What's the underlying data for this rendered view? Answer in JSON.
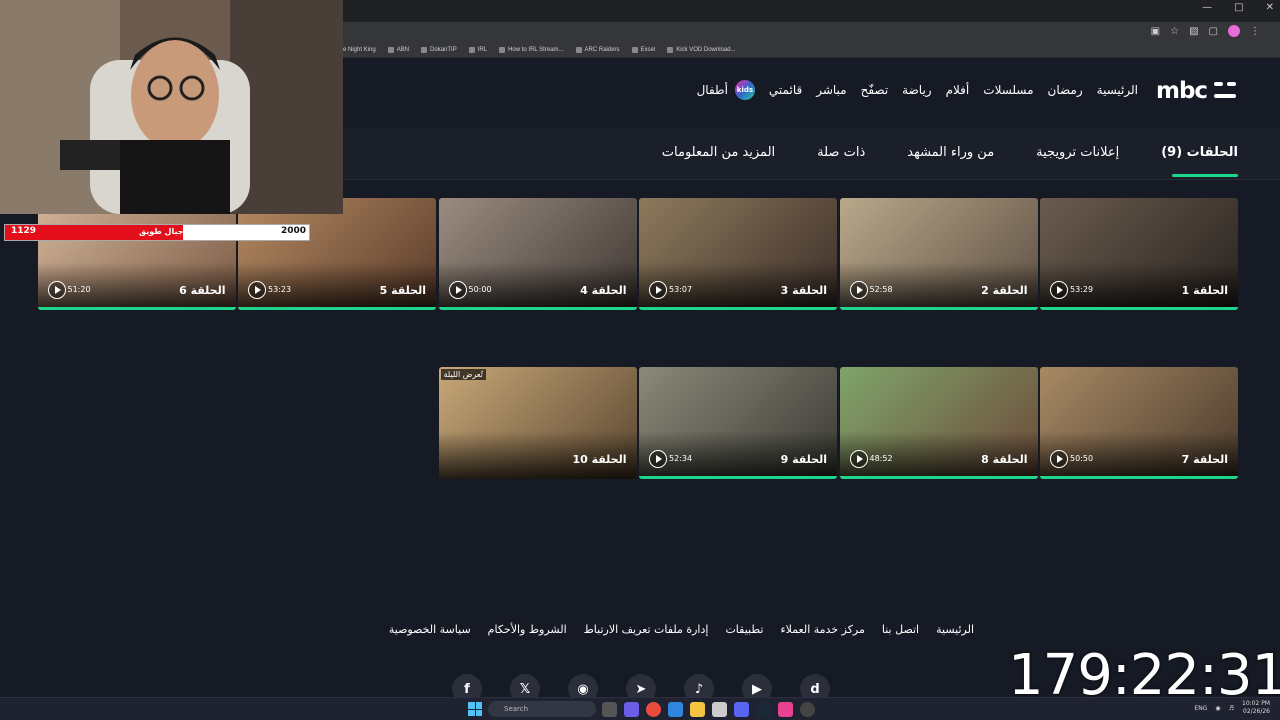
{
  "browser": {
    "bookmarks": [
      "e Night King",
      "ABN",
      "DokanTIP",
      "IRL",
      "How to IRL Stream...",
      "ARC Raiders",
      "Excel",
      "Kick VOD Download..."
    ]
  },
  "site": {
    "logo": "mbc",
    "nav": [
      "الرئيسية",
      "رمضان",
      "مسلسلات",
      "أفلام",
      "رياضة",
      "تصفّح",
      "مباشر",
      "قائمتي"
    ],
    "nav_kids_label": "أطفال",
    "kids_badge": "kids",
    "tabs": [
      "الحلقات (9)",
      "إعلانات ترويجية",
      "من وراء المشهد",
      "ذات صلة",
      "المزيد من المعلومات"
    ],
    "episodes": [
      {
        "title": "الحلقة 1",
        "duration": "53:29"
      },
      {
        "title": "الحلقة 2",
        "duration": "52:58"
      },
      {
        "title": "الحلقة 3",
        "duration": "53:07"
      },
      {
        "title": "الحلقة 4",
        "duration": "50:00"
      },
      {
        "title": "الحلقة 5",
        "duration": "53:23"
      },
      {
        "title": "الحلقة 6",
        "duration": "51:20"
      },
      {
        "title": "الحلقة 7",
        "duration": "50:50"
      },
      {
        "title": "الحلقة 8",
        "duration": "48:52"
      },
      {
        "title": "الحلقة 9",
        "duration": "52:34"
      },
      {
        "title": "الحلقة 10",
        "duration": "",
        "badge": "تُعرض الليلة"
      }
    ],
    "footer_links": [
      "الرئيسية",
      "اتصل بنا",
      "مركز خدمة العملاء",
      "تطبيقات",
      "إدارة ملفات تعريف الارتباط",
      "الشروط والأحكام",
      "سياسة الخصوصية"
    ],
    "social": [
      "shahid-icon",
      "youtube-icon",
      "tiktok-icon",
      "telegram-icon",
      "instagram-icon",
      "x-icon",
      "facebook-icon"
    ]
  },
  "overlay": {
    "score_left": "1129",
    "score_name": "جبال طويق",
    "score_right": "2000",
    "timer": "179:22:31"
  },
  "taskbar": {
    "search": "Search",
    "lang": "ENG",
    "time": "10:02 PM",
    "date": "02/26/26"
  },
  "colors": {
    "accent": "#1ed58c",
    "bg": "#161a24",
    "score_red": "#e3101b"
  }
}
